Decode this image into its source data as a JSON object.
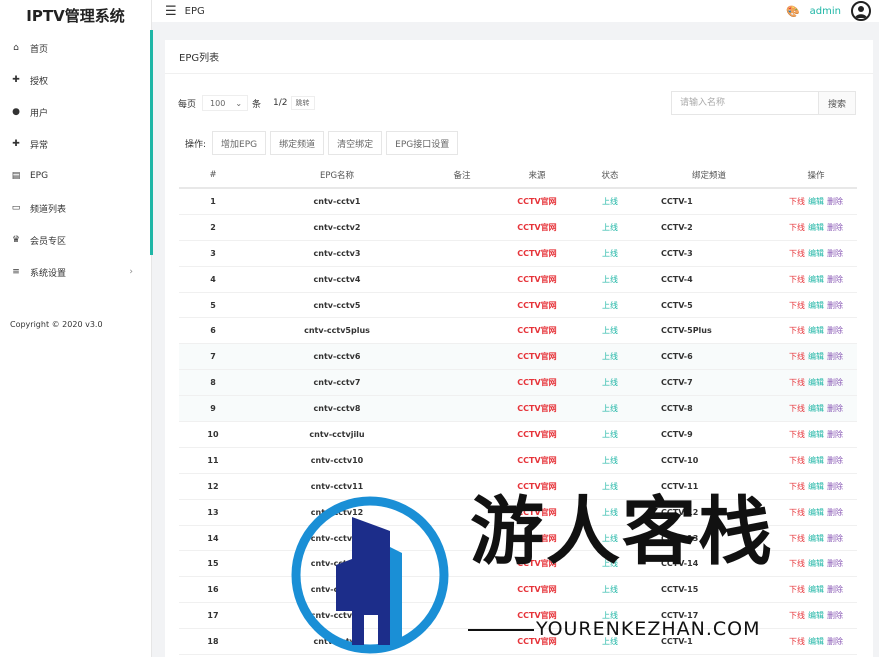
{
  "app": {
    "title": "IPTV管理系统"
  },
  "sidebar": {
    "items": [
      {
        "label": "首页",
        "icon": "home-icon",
        "glyph": "⌂"
      },
      {
        "label": "授权",
        "icon": "user-plus-icon",
        "glyph": "✚"
      },
      {
        "label": "用户",
        "icon": "user-icon",
        "glyph": "●"
      },
      {
        "label": "异常",
        "icon": "user-alert-icon",
        "glyph": "✚"
      },
      {
        "label": "EPG",
        "icon": "epg-icon",
        "glyph": "▤"
      },
      {
        "label": "频道列表",
        "icon": "tv-icon",
        "glyph": "▭"
      },
      {
        "label": "会员专区",
        "icon": "crown-icon",
        "glyph": "♛"
      },
      {
        "label": "系统设置",
        "icon": "list-icon",
        "glyph": "≡",
        "arrow": "›"
      }
    ],
    "copyright": "Copyright © 2020 v3.0"
  },
  "header": {
    "menu_glyph": "☰",
    "title": "EPG",
    "user": "admin",
    "palette_glyph": "🎨"
  },
  "card": {
    "title": "EPG列表",
    "per_page_label": "每页",
    "per_page_value": "100",
    "per_page_unit": "条",
    "page": "1/2",
    "jump_label": "跳转",
    "search": {
      "placeholder": "请输入名称",
      "button": "搜索"
    },
    "ops_label": "操作:",
    "op_buttons": [
      "增加EPG",
      "绑定频道",
      "清空绑定",
      "EPG接口设置"
    ]
  },
  "table": {
    "headers": [
      "#",
      "EPG名称",
      "备注",
      "来源",
      "状态",
      "绑定频道",
      "操作"
    ],
    "rows": [
      {
        "idx": "1",
        "name": "cntv-cctv1",
        "note": "",
        "source": "CCTV官网",
        "status": "上线",
        "channel": "CCTV-1"
      },
      {
        "idx": "2",
        "name": "cntv-cctv2",
        "note": "",
        "source": "CCTV官网",
        "status": "上线",
        "channel": "CCTV-2"
      },
      {
        "idx": "3",
        "name": "cntv-cctv3",
        "note": "",
        "source": "CCTV官网",
        "status": "上线",
        "channel": "CCTV-3"
      },
      {
        "idx": "4",
        "name": "cntv-cctv4",
        "note": "",
        "source": "CCTV官网",
        "status": "上线",
        "channel": "CCTV-4"
      },
      {
        "idx": "5",
        "name": "cntv-cctv5",
        "note": "",
        "source": "CCTV官网",
        "status": "上线",
        "channel": "CCTV-5"
      },
      {
        "idx": "6",
        "name": "cntv-cctv5plus",
        "note": "",
        "source": "CCTV官网",
        "status": "上线",
        "channel": "CCTV-5Plus"
      },
      {
        "idx": "7",
        "name": "cntv-cctv6",
        "note": "",
        "source": "CCTV官网",
        "status": "上线",
        "channel": "CCTV-6"
      },
      {
        "idx": "8",
        "name": "cntv-cctv7",
        "note": "",
        "source": "CCTV官网",
        "status": "上线",
        "channel": "CCTV-7"
      },
      {
        "idx": "9",
        "name": "cntv-cctv8",
        "note": "",
        "source": "CCTV官网",
        "status": "上线",
        "channel": "CCTV-8"
      },
      {
        "idx": "10",
        "name": "cntv-cctvjilu",
        "note": "",
        "source": "CCTV官网",
        "status": "上线",
        "channel": "CCTV-9"
      },
      {
        "idx": "11",
        "name": "cntv-cctv10",
        "note": "",
        "source": "CCTV官网",
        "status": "上线",
        "channel": "CCTV-10"
      },
      {
        "idx": "12",
        "name": "cntv-cctv11",
        "note": "",
        "source": "CCTV官网",
        "status": "上线",
        "channel": "CCTV-11"
      },
      {
        "idx": "13",
        "name": "cntv-cctv12",
        "note": "",
        "source": "CCTV官网",
        "status": "上线",
        "channel": "CCTV-12"
      },
      {
        "idx": "14",
        "name": "cntv-cctv13",
        "note": "",
        "source": "CCTV官网",
        "status": "上线",
        "channel": "CCTV-13"
      },
      {
        "idx": "15",
        "name": "cntv-cctv14",
        "note": "",
        "source": "CCTV官网",
        "status": "上线",
        "channel": "CCTV-14"
      },
      {
        "idx": "16",
        "name": "cntv-cctv15",
        "note": "",
        "source": "CCTV官网",
        "status": "上线",
        "channel": "CCTV-15"
      },
      {
        "idx": "17",
        "name": "cntv-cctv17",
        "note": "",
        "source": "CCTV官网",
        "status": "上线",
        "channel": "CCTV-17"
      },
      {
        "idx": "18",
        "name": "cntv-cctv1",
        "note": "",
        "source": "CCTV官网",
        "status": "上线",
        "channel": "CCTV-1"
      }
    ],
    "actions": {
      "down": "下线",
      "edit": "编辑",
      "delete": "删除"
    }
  },
  "watermark": {
    "text": "游人客栈",
    "sub": "YOURENKEZHAN.COM",
    "colors": {
      "ring": "#1a8fd6",
      "tower": "#1c2d8a"
    }
  },
  "colors": {
    "accent": "#1fb6a6",
    "danger": "#e6343a",
    "delete": "#8a5ab6"
  }
}
